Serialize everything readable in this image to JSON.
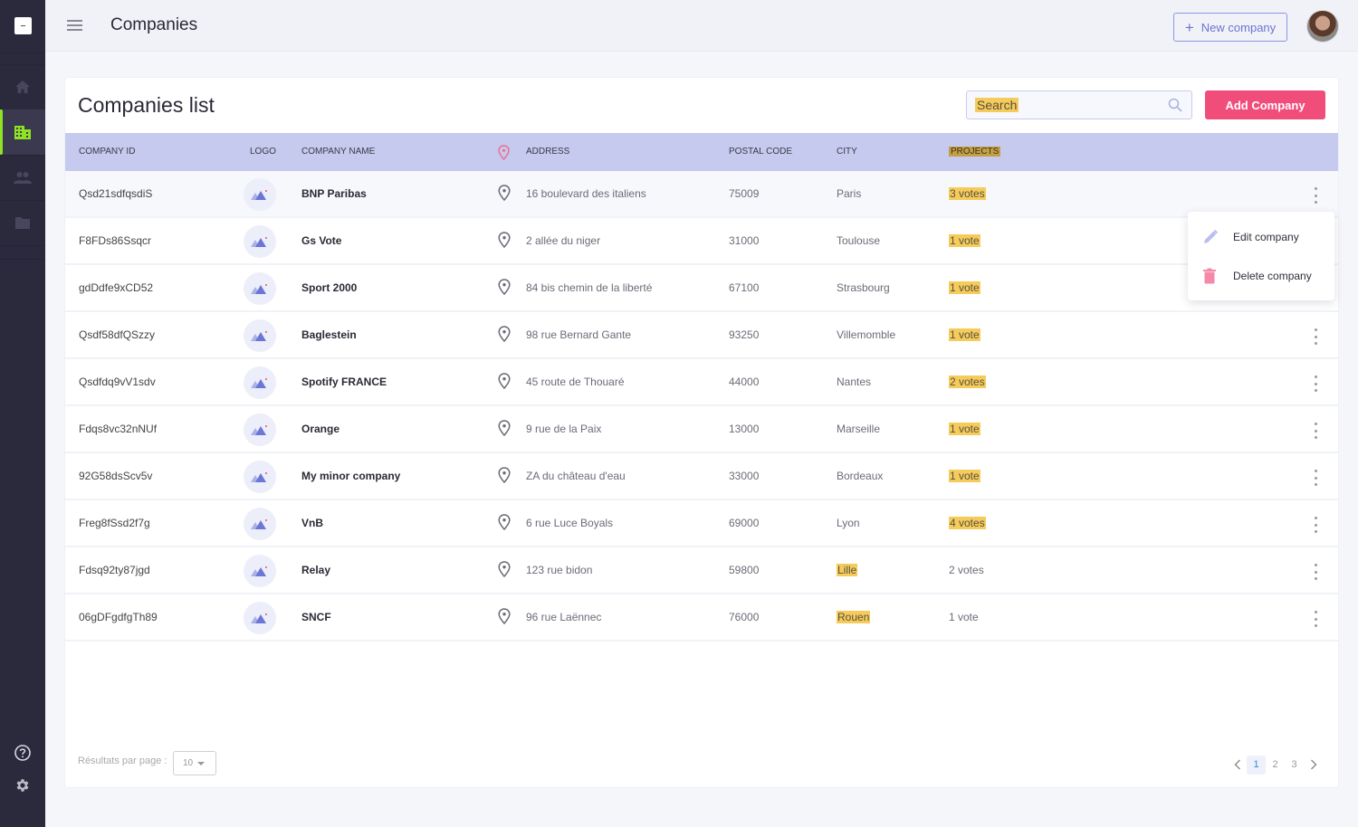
{
  "app": {
    "page_title": "Companies",
    "new_company_label": "New company",
    "nav": [
      {
        "name": "home",
        "icon": "home-icon",
        "active": false
      },
      {
        "name": "companies",
        "icon": "building-icon",
        "active": true
      },
      {
        "name": "users",
        "icon": "people-icon",
        "active": false
      },
      {
        "name": "files",
        "icon": "folder-icon",
        "active": false
      }
    ],
    "bottom_nav": [
      {
        "name": "help",
        "icon": "help-circle-icon"
      },
      {
        "name": "settings",
        "icon": "gear-icon"
      }
    ],
    "colors": {
      "sidebar": "#2b2a3d",
      "accent_active": "#8fe223",
      "primary": "#f04d7b",
      "header_row": "#c5caee",
      "highlight": "#f5cc5b"
    }
  },
  "list": {
    "title": "Companies list",
    "search_placeholder": "Search",
    "add_label": "Add Company",
    "columns": {
      "id": "COMPANY ID",
      "logo": "LOGO",
      "name": "COMPANY NAME",
      "address": "ADDRESS",
      "postal": "POSTAL CODE",
      "city": "CITY",
      "projects": "PROJECTS"
    },
    "rows": [
      {
        "id": "Qsd21sdfqsdiS",
        "name": "BNP Paribas",
        "address": "16 boulevard des italiens",
        "postal": "75009",
        "city": "Paris",
        "projects": "3 votes",
        "city_hl": false,
        "proj_hl": true
      },
      {
        "id": "F8FDs86Ssqcr",
        "name": "Gs Vote",
        "address": "2 allée du niger",
        "postal": "31000",
        "city": "Toulouse",
        "projects": "1 vote",
        "city_hl": false,
        "proj_hl": true
      },
      {
        "id": "gdDdfe9xCD52",
        "name": "Sport 2000",
        "address": "84 bis chemin de la liberté",
        "postal": "67100",
        "city": "Strasbourg",
        "projects": "1 vote",
        "city_hl": false,
        "proj_hl": true
      },
      {
        "id": "Qsdf58dfQSzzy",
        "name": "Baglestein",
        "address": "98 rue Bernard Gante",
        "postal": "93250",
        "city": "Villemomble",
        "projects": "1 vote",
        "city_hl": false,
        "proj_hl": true
      },
      {
        "id": "Qsdfdq9vV1sdv",
        "name": "Spotify FRANCE",
        "address": "45 route de Thouaré",
        "postal": "44000",
        "city": "Nantes",
        "projects": "2 votes",
        "city_hl": false,
        "proj_hl": true
      },
      {
        "id": "Fdqs8vc32nNUf",
        "name": "Orange",
        "address": "9 rue de la Paix",
        "postal": "13000",
        "city": "Marseille",
        "projects": "1 vote",
        "city_hl": false,
        "proj_hl": true
      },
      {
        "id": "92G58dsScv5v",
        "name": "My minor company",
        "address": "ZA du château d'eau",
        "postal": "33000",
        "city": "Bordeaux",
        "projects": "1 vote",
        "city_hl": false,
        "proj_hl": true
      },
      {
        "id": "Freg8fSsd2f7g",
        "name": "VnB",
        "address": "6 rue Luce Boyals",
        "postal": "69000",
        "city": "Lyon",
        "projects": "4 votes",
        "city_hl": false,
        "proj_hl": true
      },
      {
        "id": "Fdsq92ty87jgd",
        "name": "Relay",
        "address": "123 rue bidon",
        "postal": "59800",
        "city": "Lille",
        "projects": "2 votes",
        "city_hl": true,
        "proj_hl": false
      },
      {
        "id": "06gDFgdfgTh89",
        "name": "SNCF",
        "address": "96 rue Laënnec",
        "postal": "76000",
        "city": "Rouen",
        "projects": "1 vote",
        "city_hl": true,
        "proj_hl": false
      }
    ],
    "context_menu": {
      "edit_label": "Edit company",
      "delete_label": "Delete company"
    },
    "footer": {
      "rpp_label": "Résultats par page :",
      "rpp_value": "10",
      "pages": [
        "1",
        "2",
        "3"
      ],
      "current_page": "1"
    }
  }
}
